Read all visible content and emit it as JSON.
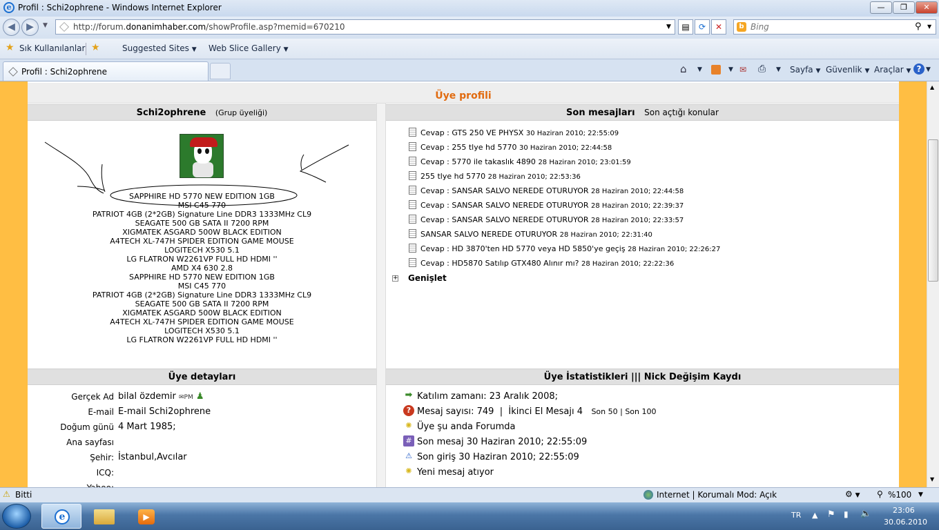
{
  "window": {
    "title": "Profil : Schi2ophrene - Windows Internet Explorer"
  },
  "address": {
    "url_prefix": "http://forum.",
    "url_domain": "donanimhaber.com",
    "url_rest": "/showProfile.asp?memid=670210"
  },
  "search": {
    "placeholder": "Bing"
  },
  "favorites": {
    "favorites_label": "Sık Kullanılanlar",
    "suggested_sites": "Suggested Sites",
    "web_slice_gallery": "Web Slice Gallery"
  },
  "tab": {
    "label": "Profil : Schi2ophrene"
  },
  "commandbar": {
    "page": "Sayfa",
    "safety": "Güvenlik",
    "tools": "Araçlar"
  },
  "page": {
    "header": "Üye profili",
    "profile": {
      "username": "Schi2ophrene",
      "group": "(Grup üyeliği)",
      "signature": [
        "SAPPHIRE HD 5770 NEW EDITION 1GB",
        "MSI C45 770",
        "PATRIOT 4GB (2*2GB) Signature Line DDR3 1333MHz CL9",
        "SEAGATE 500 GB SATA II 7200 RPM",
        "XIGMATEK ASGARD 500W BLACK EDITION",
        "A4TECH XL-747H SPIDER EDITION GAME MOUSE",
        "LOGITECH X530 5.1",
        "LG FLATRON W2261VP FULL HD HDMI ''",
        "AMD X4 630 2.8",
        "SAPPHIRE HD 5770 NEW EDITION 1GB",
        "MSI C45 770",
        "PATRIOT 4GB (2*2GB) Signature Line DDR3 1333MHz CL9",
        "SEAGATE 500 GB SATA II 7200 RPM",
        "XIGMATEK ASGARD 500W BLACK EDITION",
        "A4TECH XL-747H SPIDER EDITION GAME MOUSE",
        "LOGITECH X530 5.1",
        "LG FLATRON W2261VP FULL HD HDMI ''"
      ]
    },
    "recent": {
      "title": "Son mesajları",
      "subtitle": "Son açtığı konular",
      "posts": [
        {
          "subject": "Cevap : GTS 250 VE PHYSX",
          "date": "30 Haziran 2010; 22:55:09"
        },
        {
          "subject": "Cevap : 255 tlye hd 5770",
          "date": "30 Haziran 2010; 22:44:58"
        },
        {
          "subject": "Cevap : 5770 ile takaslık 4890",
          "date": "28 Haziran 2010; 23:01:59"
        },
        {
          "subject": "255 tlye hd 5770",
          "date": "28 Haziran 2010; 22:53:36"
        },
        {
          "subject": "Cevap : SANSAR SALVO NEREDE OTURUYOR",
          "date": "28 Haziran 2010; 22:44:58"
        },
        {
          "subject": "Cevap : SANSAR SALVO NEREDE OTURUYOR",
          "date": "28 Haziran 2010; 22:39:37"
        },
        {
          "subject": "Cevap : SANSAR SALVO NEREDE OTURUYOR",
          "date": "28 Haziran 2010; 22:33:57"
        },
        {
          "subject": "SANSAR SALVO NEREDE OTURUYOR",
          "date": "28 Haziran 2010; 22:31:40"
        },
        {
          "subject": "Cevap : HD 3870'ten HD 5770 veya HD 5850'ye geçiş",
          "date": "28 Haziran 2010; 22:26:27"
        },
        {
          "subject": "Cevap : HD5870 Satılıp GTX480 Alınır mı?",
          "date": "28 Haziran 2010; 22:22:36"
        }
      ],
      "expand": "Genişlet"
    },
    "details": {
      "title": "Üye detayları",
      "rows": [
        {
          "key": "Gerçek Ad",
          "value": "bilal özdemir"
        },
        {
          "key": "E-mail",
          "value": "E-mail Schi2ophrene"
        },
        {
          "key": "Doğum günü",
          "value": "4 Mart 1985;"
        },
        {
          "key": "Ana sayfası",
          "value": ""
        },
        {
          "key": "Şehir:",
          "value": "İstanbul,Avcılar"
        },
        {
          "key": "ICQ:",
          "value": ""
        },
        {
          "key": "Yahoo:",
          "value": ""
        }
      ],
      "pm_label": "PM"
    },
    "stats": {
      "title": "Üye İstatistikleri  |||  Nick Değişim Kaydı",
      "join": "Katılım zamanı: 23 Aralık 2008;",
      "messages": "Mesaj sayısı: 749",
      "secondhand": "İkinci El Mesajı 4",
      "last50": "Son 50",
      "last100": "Son 100",
      "online": "Üye şu anda Forumda",
      "last_message": "Son mesaj 30 Haziran 2010; 22:55:09",
      "last_login": "Son giriş 30 Haziran 2010; 22:55:09",
      "new_message": "Yeni mesaj atıyor"
    }
  },
  "statusbar": {
    "left": "Bitti",
    "zone": "Internet | Korumalı Mod: Açık",
    "zoom": "%100"
  },
  "taskbar": {
    "lang": "TR",
    "time": "23:06",
    "date": "30.06.2010"
  }
}
